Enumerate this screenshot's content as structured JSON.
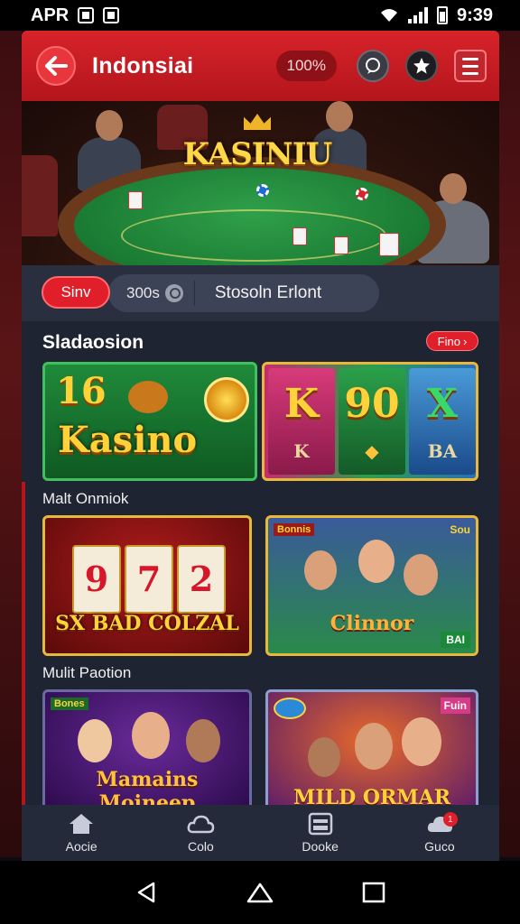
{
  "status_bar": {
    "left_text": "APR",
    "time": "9:39"
  },
  "header": {
    "title": "Indonsiai",
    "balance": "100%"
  },
  "banner": {
    "logo_text": "KASINIU"
  },
  "filters": {
    "active_chip": "Sinv",
    "count": "300s",
    "search_label": "Stosoln Erlont"
  },
  "sections": {
    "main_title": "Sladaosion",
    "more_label": "Fino",
    "sub_title_1": "Malt Onmiok",
    "sub_title_2": "Mulit Paotion"
  },
  "games": [
    {
      "num": "16",
      "title": "Kasino"
    },
    {
      "reels": [
        "K",
        "90",
        "X"
      ],
      "reels_sub": [
        "K",
        "",
        "BA"
      ]
    },
    {
      "reels": [
        "9",
        "7",
        "2"
      ],
      "title": "SX BAD COLZAL"
    },
    {
      "tag_left": "Bonnis",
      "tag_right": "Sou",
      "title": "Clinnor",
      "badge": "BAI"
    },
    {
      "tag_left": "Bones",
      "title": "Mamains Moineep"
    },
    {
      "tag_right": "Fuin",
      "title": "MILD ORMAR"
    }
  ],
  "bottom_nav": [
    {
      "label": "Aocie",
      "icon": "home-icon"
    },
    {
      "label": "Colo",
      "icon": "cloud-icon"
    },
    {
      "label": "Dooke",
      "icon": "grid-icon"
    },
    {
      "label": "Guco",
      "icon": "chat-icon",
      "badge": "1"
    }
  ],
  "colors": {
    "brand_red": "#d8232a",
    "app_bg": "#1f2433"
  }
}
